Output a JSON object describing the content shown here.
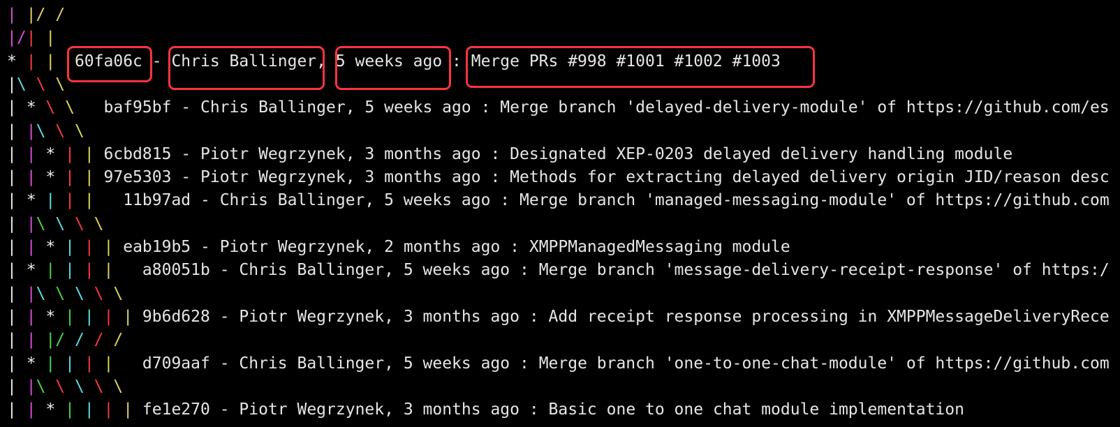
{
  "colors": {
    "background": "#000000",
    "text": "#e6e6e6",
    "highlight_border": "#ff3344",
    "graph": {
      "m": "#d94fd9",
      "y": "#e0d55a",
      "c": "#59e0e6",
      "g": "#46d946",
      "r": "#ff3b3b",
      "w": "#ededed"
    }
  },
  "lines": [
    {
      "graph": [
        [
          "| ",
          "m"
        ],
        [
          "|/ /",
          "y"
        ]
      ],
      "text": ""
    },
    {
      "graph": [
        [
          "|/",
          "m"
        ],
        [
          "| ",
          "r"
        ],
        [
          "|",
          "y"
        ]
      ],
      "text": ""
    },
    {
      "graph": [
        [
          "* ",
          "w"
        ],
        [
          "| ",
          "r"
        ],
        [
          "|  ",
          "y"
        ]
      ],
      "hash": "60fa06c",
      "sep1": " - ",
      "author": "Chris Ballinger",
      "sep2": ", ",
      "date": "5 weeks ago",
      "sep3": " : ",
      "message": "Merge PRs #998 #1001 #1002 #1003"
    },
    {
      "graph": [
        [
          "|",
          "w"
        ],
        [
          "\\ ",
          "c"
        ],
        [
          "\\ ",
          "r"
        ],
        [
          "\\",
          "y"
        ]
      ],
      "text": ""
    },
    {
      "graph": [
        [
          "| ",
          "w"
        ],
        [
          "* ",
          "w"
        ],
        [
          "\\ ",
          "r"
        ],
        [
          "\\   ",
          "y"
        ]
      ],
      "hash": "baf95bf",
      "sep1": " - ",
      "author": "Chris Ballinger",
      "sep2": ", ",
      "date": "5 weeks ago",
      "sep3": " : ",
      "message": "Merge branch 'delayed-delivery-module' of https://github.com/es"
    },
    {
      "graph": [
        [
          "| ",
          "w"
        ],
        [
          "|",
          "m"
        ],
        [
          "\\ ",
          "c"
        ],
        [
          "\\ ",
          "r"
        ],
        [
          "\\",
          "y"
        ]
      ],
      "text": ""
    },
    {
      "graph": [
        [
          "| ",
          "w"
        ],
        [
          "| ",
          "m"
        ],
        [
          "* ",
          "w"
        ],
        [
          "| ",
          "r"
        ],
        [
          "| ",
          "y"
        ]
      ],
      "hash": "6cbd815",
      "sep1": " - ",
      "author": "Piotr Wegrzynek",
      "sep2": ", ",
      "date": "3 months ago",
      "sep3": " : ",
      "message": "Designated XEP-0203 delayed delivery handling module"
    },
    {
      "graph": [
        [
          "| ",
          "w"
        ],
        [
          "| ",
          "m"
        ],
        [
          "* ",
          "w"
        ],
        [
          "| ",
          "r"
        ],
        [
          "| ",
          "y"
        ]
      ],
      "hash": "97e5303",
      "sep1": " - ",
      "author": "Piotr Wegrzynek",
      "sep2": ", ",
      "date": "3 months ago",
      "sep3": " : ",
      "message": "Methods for extracting delayed delivery origin JID/reason desc"
    },
    {
      "graph": [
        [
          "| ",
          "w"
        ],
        [
          "* ",
          "w"
        ],
        [
          "| ",
          "c"
        ],
        [
          "| ",
          "r"
        ],
        [
          "|   ",
          "y"
        ]
      ],
      "hash": "11b97ad",
      "sep1": " - ",
      "author": "Chris Ballinger",
      "sep2": ", ",
      "date": "5 weeks ago",
      "sep3": " : ",
      "message": "Merge branch 'managed-messaging-module' of https://github.com"
    },
    {
      "graph": [
        [
          "| ",
          "w"
        ],
        [
          "|",
          "m"
        ],
        [
          "\\ ",
          "g"
        ],
        [
          "\\ ",
          "c"
        ],
        [
          "\\ ",
          "r"
        ],
        [
          "\\",
          "y"
        ]
      ],
      "text": ""
    },
    {
      "graph": [
        [
          "| ",
          "w"
        ],
        [
          "| ",
          "m"
        ],
        [
          "* ",
          "w"
        ],
        [
          "| ",
          "c"
        ],
        [
          "| ",
          "r"
        ],
        [
          "| ",
          "y"
        ]
      ],
      "hash": "eab19b5",
      "sep1": " - ",
      "author": "Piotr Wegrzynek",
      "sep2": ", ",
      "date": "2 months ago",
      "sep3": " : ",
      "message": "XMPPManagedMessaging module"
    },
    {
      "graph": [
        [
          "| ",
          "w"
        ],
        [
          "* ",
          "w"
        ],
        [
          "| ",
          "g"
        ],
        [
          "| ",
          "c"
        ],
        [
          "| ",
          "r"
        ],
        [
          "|   ",
          "y"
        ]
      ],
      "hash": "a80051b",
      "sep1": " - ",
      "author": "Chris Ballinger",
      "sep2": ", ",
      "date": "5 weeks ago",
      "sep3": " : ",
      "message": "Merge branch 'message-delivery-receipt-response' of https:/"
    },
    {
      "graph": [
        [
          "| ",
          "w"
        ],
        [
          "|",
          "m"
        ],
        [
          "\\ ",
          "c"
        ],
        [
          "\\ ",
          "g"
        ],
        [
          "\\ ",
          "c"
        ],
        [
          "\\ ",
          "r"
        ],
        [
          "\\",
          "y"
        ]
      ],
      "text": ""
    },
    {
      "graph": [
        [
          "| ",
          "w"
        ],
        [
          "| ",
          "m"
        ],
        [
          "* ",
          "w"
        ],
        [
          "| ",
          "g"
        ],
        [
          "| ",
          "c"
        ],
        [
          "| ",
          "r"
        ],
        [
          "| ",
          "y"
        ]
      ],
      "hash": "9b6d628",
      "sep1": " - ",
      "author": "Piotr Wegrzynek",
      "sep2": ", ",
      "date": "3 months ago",
      "sep3": " : ",
      "message": "Add receipt response processing in XMPPMessageDeliveryRece"
    },
    {
      "graph": [
        [
          "| ",
          "w"
        ],
        [
          "| ",
          "m"
        ],
        [
          "|/ ",
          "g"
        ],
        [
          "/ ",
          "c"
        ],
        [
          "/ ",
          "r"
        ],
        [
          "/",
          "y"
        ]
      ],
      "text": ""
    },
    {
      "graph": [
        [
          "| ",
          "w"
        ],
        [
          "* ",
          "w"
        ],
        [
          "| ",
          "g"
        ],
        [
          "| ",
          "c"
        ],
        [
          "| ",
          "r"
        ],
        [
          "|   ",
          "y"
        ]
      ],
      "hash": "d709aaf",
      "sep1": " - ",
      "author": "Chris Ballinger",
      "sep2": ", ",
      "date": "5 weeks ago",
      "sep3": " : ",
      "message": "Merge branch 'one-to-one-chat-module' of https://github.com"
    },
    {
      "graph": [
        [
          "| ",
          "w"
        ],
        [
          "|",
          "m"
        ],
        [
          "\\ ",
          "g"
        ],
        [
          "\\ ",
          "r"
        ],
        [
          "\\ ",
          "c"
        ],
        [
          "\\ ",
          "r"
        ],
        [
          "\\",
          "y"
        ]
      ],
      "text": ""
    },
    {
      "graph": [
        [
          "| ",
          "w"
        ],
        [
          "| ",
          "m"
        ],
        [
          "* ",
          "w"
        ],
        [
          "| ",
          "g"
        ],
        [
          "| ",
          "c"
        ],
        [
          "| ",
          "r"
        ],
        [
          "| ",
          "y"
        ]
      ],
      "hash": "fe1e270",
      "sep1": " - ",
      "author": "Piotr Wegrzynek",
      "sep2": ", ",
      "date": "3 months ago",
      "sep3": " : ",
      "message": "Basic one to one chat module implementation"
    }
  ]
}
